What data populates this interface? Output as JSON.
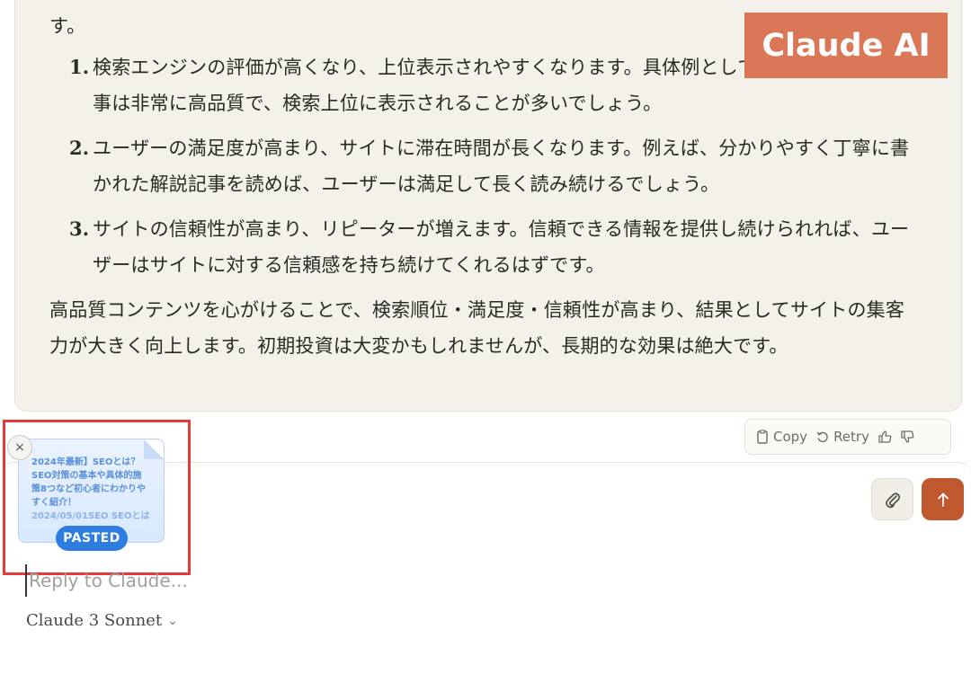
{
  "badge": {
    "label": "Claude AI"
  },
  "message": {
    "intro": "はい、分かりました。SEO対策の高品質なコンテンツを作成することには、大きなメリットがあります。",
    "items": [
      {
        "num": "1.",
        "text": "検索エンジンの評価が高くなり、上位表示されやすくなります。具体例として、Wikipediaの記事は非常に高品質で、検索上位に表示されることが多いでしょう。"
      },
      {
        "num": "2.",
        "text": "ユーザーの満足度が高まり、サイトに滞在時間が長くなります。例えば、分かりやすく丁寧に書かれた解説記事を読めば、ユーザーは満足して長く読み続けるでしょう。"
      },
      {
        "num": "3.",
        "text": "サイトの信頼性が高まり、リピーターが増えます。信頼できる情報を提供し続けられれば、ユーザーはサイトに対する信頼感を持ち続けてくれるはずです。"
      }
    ],
    "closing": "高品質コンテンツを心がけることで、検索順位・満足度・信頼性が高まり、結果としてサイトの集客力が大きく向上します。初期投資は大変かもしれませんが、長期的な効果は絶大です。"
  },
  "actions": {
    "copy": "Copy",
    "retry": "Retry"
  },
  "attachment": {
    "preview_title": "2024年最新】SEOとは？SEO対策の基本や具体的施策8つなど初心者にわかりやすく紹介！",
    "preview_sub": "2024/05/01SEO SEOとは",
    "pill": "PASTED",
    "close": "×"
  },
  "composer": {
    "placeholder": "Reply to Claude...",
    "model": "Claude 3 Sonnet",
    "model_chevron": "⌄"
  },
  "colors": {
    "accent": "#d97757",
    "send": "#c0582f",
    "pasted_pill": "#2e7de0",
    "highlight": "#e63a3a"
  }
}
